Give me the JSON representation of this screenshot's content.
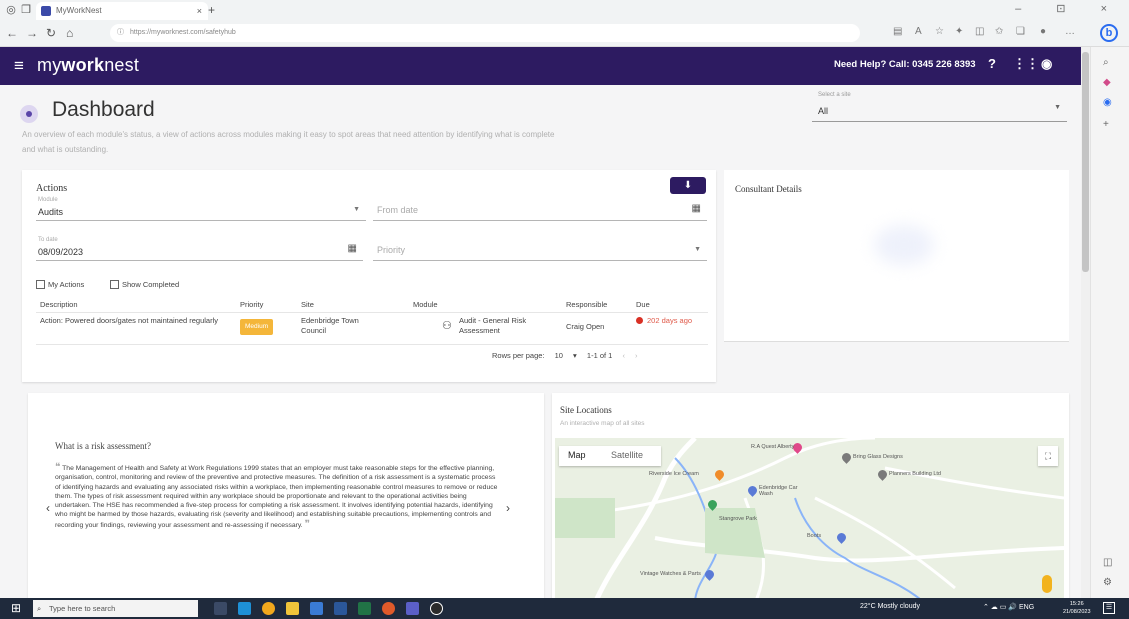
{
  "browser": {
    "tab_title": "MyWorkNest",
    "tab_close": "×",
    "new_tab": "+",
    "url": "https://myworknest.com/safetyhub",
    "window_controls": "– ⊡ ×"
  },
  "app": {
    "brand_light": "my",
    "brand_bold": "work",
    "brand_tail": "nest",
    "help_text": "Need Help? Call: 0345 226 8393"
  },
  "header": {
    "title": "Dashboard",
    "subtitle": "An overview of each module's status, a view of actions across modules making it easy to spot areas that need attention by identifying what is complete and what is outstanding.",
    "site_select_label": "Select a site",
    "site_select_value": "All"
  },
  "actions": {
    "title": "Actions",
    "download_icon": "⬇",
    "module_label": "Module",
    "module_value": "Audits",
    "from_date_placeholder": "From date",
    "to_date_label": "To date",
    "to_date_value": "08/09/2023",
    "priority_placeholder": "Priority",
    "my_actions_label": "My Actions",
    "show_completed_label": "Show Completed",
    "columns": [
      "Description",
      "Priority",
      "Site",
      "Module",
      "Responsible",
      "Due"
    ],
    "row": {
      "description": "Action: Powered doors/gates not maintained regularly",
      "priority": "Medium",
      "site": "Edenbridge Town Council",
      "module": "Audit - General Risk Assessment",
      "responsible": "Craig Open",
      "due": "202 days ago"
    },
    "rows_per_page_label": "Rows per page:",
    "rows_per_page_value": "10",
    "page_range": "1-1 of 1"
  },
  "consultant": {
    "title": "Consultant Details"
  },
  "risk": {
    "title": "What is a risk assessment?",
    "open_quote": "❝",
    "close_quote": "❞",
    "body": "The Management of Health and Safety at Work Regulations 1999 states that an employer must take reasonable steps for the effective planning, organisation, control, monitoring and review of the preventive and protective measures. The definition of a risk assessment is a systematic process of identifying hazards and evaluating any associated risks within a workplace, then implementing reasonable control measures to remove or reduce them. The types of risk assessment required within any workplace should be proportionate and relevant to the operational activities being undertaken. The HSE has recommended a five-step process for completing a risk assessment. It involves identifying potential hazards, identifying who might be harmed by those hazards, evaluating risk (severity and likelihood) and establishing suitable precautions, implementing controls and recording your findings, reviewing your assessment and re-assessing if necessary."
  },
  "site_locations": {
    "title": "Site Locations",
    "subtitle": "An interactive map of all sites",
    "map_tab": "Map",
    "satellite_tab": "Satellite",
    "places": [
      {
        "name": "R.A Quest Alberty",
        "color": "#e0488a"
      },
      {
        "name": "Riverside Ice Cream",
        "color": "#f08c2a"
      },
      {
        "name": "Edenbridge Car Wash",
        "color": "#5a7ad6"
      },
      {
        "name": "Stangrove Park",
        "color": "#3aa35c"
      },
      {
        "name": "Bring Glass Designs",
        "color": "#7a7a7a"
      },
      {
        "name": "Planners Building Ltd",
        "color": "#7a7a7a"
      },
      {
        "name": "Boots",
        "color": "#5a7ad6"
      },
      {
        "name": "Vintage Watches & Parts",
        "color": "#5a7ad6"
      }
    ]
  },
  "taskbar": {
    "search_placeholder": "Type here to search",
    "weather": "22°C Mostly cloudy",
    "tray": "ENG",
    "time": "15:26",
    "date": "21/08/2023"
  },
  "colors": {
    "brand": "#2d1b61",
    "priority_medium": "#f4b63a",
    "overdue": "#d93025"
  }
}
